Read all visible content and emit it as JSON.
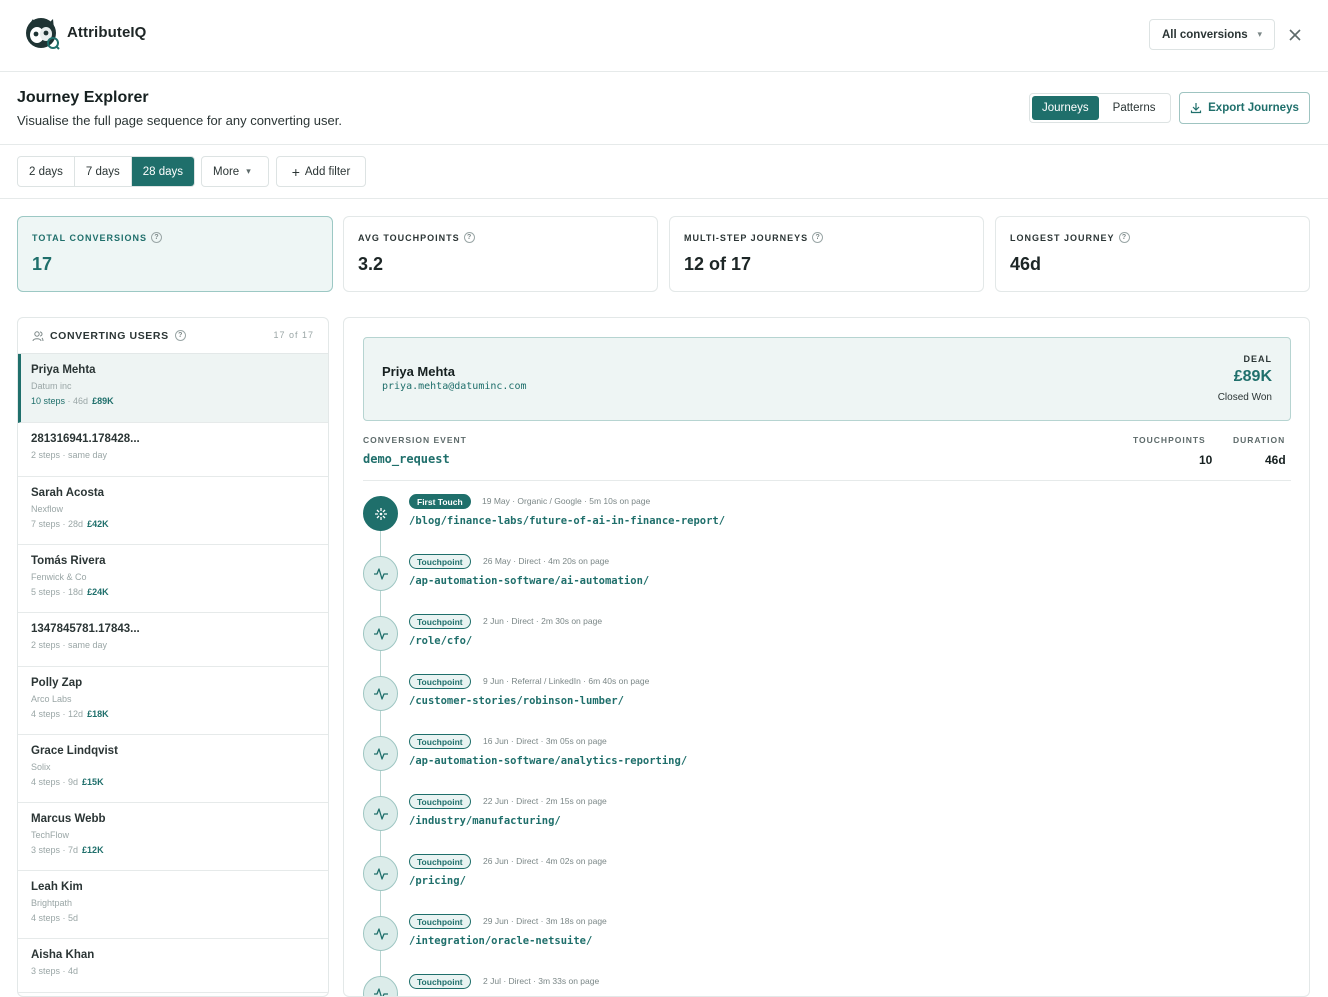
{
  "app": {
    "brand": "AttributeIQ"
  },
  "topbar": {
    "conversion_select": "All conversions"
  },
  "header": {
    "title": "Journey Explorer",
    "subtitle": "Visualise the full page sequence for any converting user.",
    "views": [
      "Journeys",
      "Patterns"
    ],
    "export_label": "Export Journeys"
  },
  "filters": {
    "ranges": [
      "2 days",
      "7 days",
      "28 days"
    ],
    "more_label": "More",
    "add_filter_label": "Add filter"
  },
  "kpis": [
    {
      "label": "TOTAL CONVERSIONS",
      "value": "17"
    },
    {
      "label": "AVG TOUCHPOINTS",
      "value": "3.2"
    },
    {
      "label": "MULTI-STEP JOURNEYS",
      "value": "12 of 17"
    },
    {
      "label": "LONGEST JOURNEY",
      "value": "46d"
    }
  ],
  "users": {
    "title": "CONVERTING USERS",
    "count": "17 of 17",
    "items": [
      {
        "name": "Priya Mehta",
        "company": "Datum inc",
        "steps": "10 steps",
        "duration": "46d",
        "value": "£89K"
      },
      {
        "name": "281316941.178428...",
        "company": "",
        "steps": "2 steps",
        "duration": "same day",
        "value": ""
      },
      {
        "name": "Sarah Acosta",
        "company": "Nexflow",
        "steps": "7 steps",
        "duration": "28d",
        "value": "£42K"
      },
      {
        "name": "Tomás Rivera",
        "company": "Fenwick & Co",
        "steps": "5 steps",
        "duration": "18d",
        "value": "£24K"
      },
      {
        "name": "1347845781.17843...",
        "company": "",
        "steps": "2 steps",
        "duration": "same day",
        "value": ""
      },
      {
        "name": "Polly Zap",
        "company": "Arco Labs",
        "steps": "4 steps",
        "duration": "12d",
        "value": "£18K"
      },
      {
        "name": "Grace Lindqvist",
        "company": "Solix",
        "steps": "4 steps",
        "duration": "9d",
        "value": "£15K"
      },
      {
        "name": "Marcus Webb",
        "company": "TechFlow",
        "steps": "3 steps",
        "duration": "7d",
        "value": "£12K"
      },
      {
        "name": "Leah Kim",
        "company": "Brightpath",
        "steps": "4 steps",
        "duration": "5d",
        "value": ""
      },
      {
        "name": "Aisha Khan",
        "company": "",
        "steps": "3 steps",
        "duration": "4d",
        "value": ""
      }
    ]
  },
  "detail": {
    "name": "Priya Mehta",
    "email": "priya.mehta@datuminc.com",
    "deal_label": "DEAL",
    "deal_value": "£89K",
    "deal_status": "Closed Won",
    "conversion_event_label": "CONVERSION EVENT",
    "conversion_event": "demo_request",
    "touchpoints_label": "TOUCHPOINTS",
    "touchpoints": "10",
    "duration_label": "DURATION",
    "duration": "46d"
  },
  "timeline": [
    {
      "badge": "First Touch",
      "meta": "19 May · Organic / Google · 5m 10s on page",
      "path": "/blog/finance-labs/future-of-ai-in-finance-report/"
    },
    {
      "badge": "Touchpoint",
      "meta": "26 May · Direct · 4m 20s on page",
      "path": "/ap-automation-software/ai-automation/"
    },
    {
      "badge": "Touchpoint",
      "meta": "2 Jun · Direct · 2m 30s on page",
      "path": "/role/cfo/"
    },
    {
      "badge": "Touchpoint",
      "meta": "9 Jun · Referral / LinkedIn · 6m 40s on page",
      "path": "/customer-stories/robinson-lumber/"
    },
    {
      "badge": "Touchpoint",
      "meta": "16 Jun · Direct · 3m 05s on page",
      "path": "/ap-automation-software/analytics-reporting/"
    },
    {
      "badge": "Touchpoint",
      "meta": "22 Jun · Direct · 2m 15s on page",
      "path": "/industry/manufacturing/"
    },
    {
      "badge": "Touchpoint",
      "meta": "26 Jun · Direct · 4m 02s on page",
      "path": "/pricing/"
    },
    {
      "badge": "Touchpoint",
      "meta": "29 Jun · Direct · 3m 18s on page",
      "path": "/integration/oracle-netsuite/"
    },
    {
      "badge": "Touchpoint",
      "meta": "2 Jul · Direct · 3m 33s on page",
      "path": ""
    }
  ]
}
